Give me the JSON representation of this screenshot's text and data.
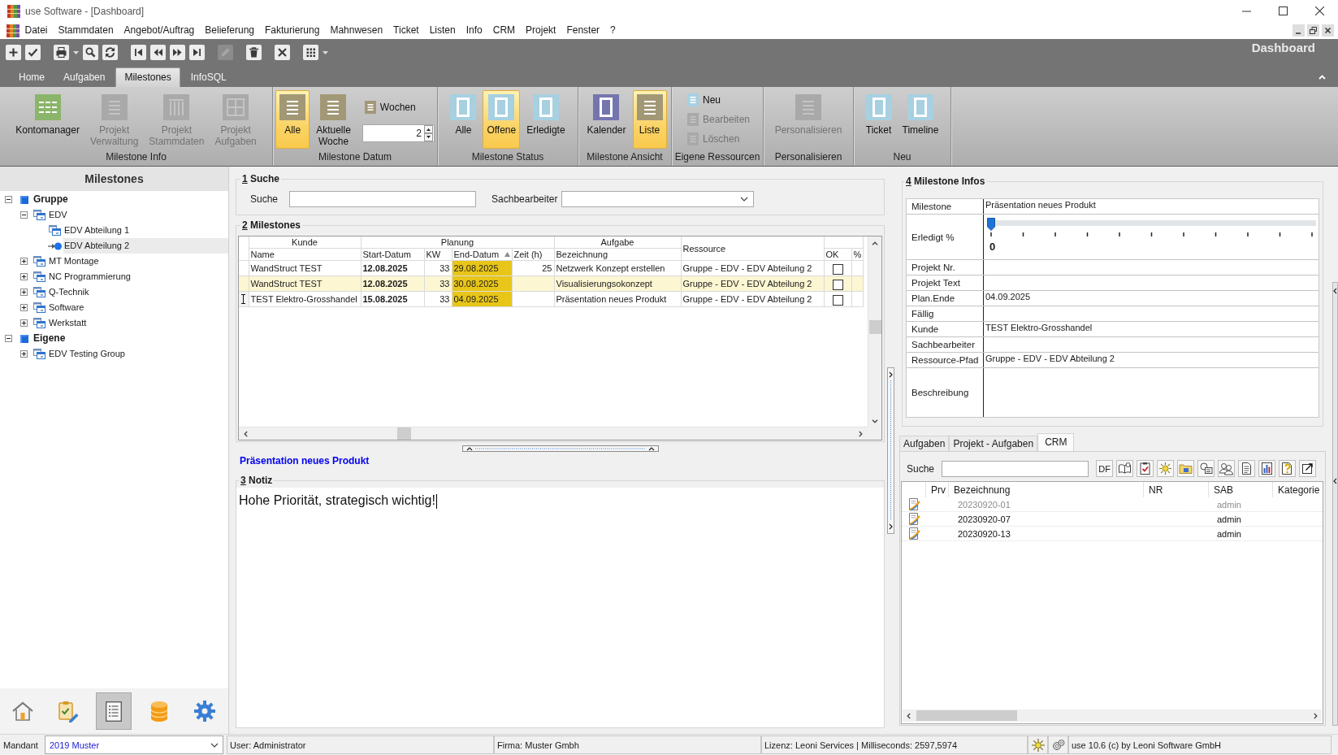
{
  "window": {
    "title": "use Software - [Dashboard]"
  },
  "menu": [
    "Datei",
    "Stammdaten",
    "Angebot/Auftrag",
    "Belieferung",
    "Fakturierung",
    "Mahnwesen",
    "Ticket",
    "Listen",
    "Info",
    "CRM",
    "Projekt",
    "Fenster",
    "?"
  ],
  "toolbar": [
    [
      {
        "kind": "add",
        "disabled": false
      },
      {
        "kind": "confirm",
        "disabled": false
      }
    ],
    [
      {
        "kind": "print",
        "disabled": false
      },
      {
        "kind": "dropdown",
        "disabled": false
      },
      {
        "kind": "search",
        "disabled": false
      },
      {
        "kind": "refresh",
        "disabled": false
      }
    ],
    [
      {
        "kind": "first",
        "disabled": false
      },
      {
        "kind": "previous",
        "disabled": false
      },
      {
        "kind": "next",
        "disabled": false
      },
      {
        "kind": "last",
        "disabled": false
      }
    ],
    [
      {
        "kind": "edit",
        "disabled": true
      }
    ],
    [
      {
        "kind": "delete",
        "disabled": false
      }
    ],
    [
      {
        "kind": "cancel",
        "disabled": false
      }
    ],
    [
      {
        "kind": "grid",
        "disabled": false
      },
      {
        "kind": "dropdown",
        "disabled": false
      }
    ]
  ],
  "ribbon": {
    "title": "Dashboard",
    "tabs": [
      {
        "label": "Home",
        "selected": false
      },
      {
        "label": "Aufgaben",
        "selected": false
      },
      {
        "label": "Milestones",
        "selected": true
      },
      {
        "label": "InfoSQL",
        "selected": false
      }
    ],
    "groups": [
      {
        "label": "Milestone Info",
        "buttons": [
          {
            "kind": "large",
            "label": "Kontomanager",
            "disabled": false,
            "selected": false
          },
          {
            "kind": "large",
            "label": "Projekt Verwaltung",
            "disabled": true,
            "selected": false
          },
          {
            "kind": "large",
            "label": "Projekt Stammdaten",
            "disabled": true,
            "selected": false
          },
          {
            "kind": "large",
            "label": "Projekt Aufgaben",
            "disabled": true,
            "selected": false
          }
        ]
      },
      {
        "label": "Milestone Datum",
        "buttons": [
          {
            "kind": "large",
            "label": "Alle",
            "disabled": false,
            "selected": true
          },
          {
            "kind": "large",
            "label": "Aktuelle Woche",
            "disabled": false,
            "selected": false
          },
          {
            "kind": "spin",
            "label": "Wochen",
            "value": "2",
            "disabled": false
          }
        ]
      },
      {
        "label": "Milestone Status",
        "buttons": [
          {
            "kind": "large",
            "label": "Alle",
            "disabled": false,
            "selected": false
          },
          {
            "kind": "large",
            "label": "Offene",
            "disabled": false,
            "selected": true
          },
          {
            "kind": "large",
            "label": "Erledigte",
            "disabled": false,
            "selected": false
          }
        ]
      },
      {
        "label": "Milestone Ansicht",
        "buttons": [
          {
            "kind": "large",
            "label": "Kalender",
            "disabled": false,
            "selected": false
          },
          {
            "kind": "large",
            "label": "Liste",
            "disabled": false,
            "selected": true
          }
        ]
      },
      {
        "label": "Eigene Ressourcen",
        "buttons": [
          {
            "kind": "small",
            "label": "Neu",
            "disabled": false
          },
          {
            "kind": "small",
            "label": "Bearbeiten",
            "disabled": true
          },
          {
            "kind": "small",
            "label": "Löschen",
            "disabled": true
          }
        ]
      },
      {
        "label": "Personalisieren",
        "buttons": [
          {
            "kind": "large",
            "label": "Personalisieren",
            "disabled": true,
            "selected": false
          }
        ]
      },
      {
        "label": "Neu",
        "buttons": [
          {
            "kind": "large",
            "label": "Ticket",
            "disabled": false,
            "selected": false
          },
          {
            "kind": "large",
            "label": "Timeline",
            "disabled": false,
            "selected": false
          }
        ]
      }
    ]
  },
  "sidebar": {
    "title": "Milestones",
    "tree": [
      {
        "kind": "root",
        "label": "Gruppe",
        "expanded": true,
        "selected": false,
        "children": [
          {
            "kind": "node",
            "label": "EDV",
            "expanded": true,
            "selected": false,
            "children": [
              {
                "kind": "leaf",
                "label": "EDV Abteilung 1",
                "selected": false
              },
              {
                "kind": "leaf",
                "label": "EDV Abteilung 2",
                "selected": true
              }
            ]
          },
          {
            "kind": "node",
            "label": "MT Montage",
            "expanded": false,
            "selected": false
          },
          {
            "kind": "node",
            "label": "NC Programmierung",
            "expanded": false,
            "selected": false
          },
          {
            "kind": "node",
            "label": "Q-Technik",
            "expanded": false,
            "selected": false
          },
          {
            "kind": "node",
            "label": "Software",
            "expanded": false,
            "selected": false
          },
          {
            "kind": "node",
            "label": "Werkstatt",
            "expanded": false,
            "selected": false
          }
        ]
      },
      {
        "kind": "root",
        "label": "Eigene",
        "expanded": true,
        "selected": false,
        "children": [
          {
            "kind": "node",
            "label": "EDV Testing Group",
            "expanded": false,
            "selected": false
          }
        ]
      }
    ],
    "nav": [
      {
        "kind": "home",
        "selected": false
      },
      {
        "kind": "tasks",
        "selected": false
      },
      {
        "kind": "list",
        "selected": true
      },
      {
        "kind": "database",
        "selected": false
      },
      {
        "kind": "settings",
        "selected": false
      }
    ]
  },
  "search": {
    "number": "1",
    "title": "Suche",
    "fields": [
      {
        "kind": "text",
        "label": "Suche"
      },
      {
        "kind": "combo",
        "label": "Sachbearbeiter"
      }
    ]
  },
  "milestones": {
    "number": "2",
    "title": "Milestones",
    "column_groups": [
      {
        "label": "Kunde",
        "columns": [
          {
            "label": "Name",
            "sorted": false
          }
        ]
      },
      {
        "label": "Planung",
        "columns": [
          {
            "label": "Start-Datum",
            "sorted": false
          },
          {
            "label": "KW",
            "sorted": false
          },
          {
            "label": "End-Datum",
            "sorted": true
          },
          {
            "label": "Zeit (h)",
            "sorted": false
          }
        ]
      },
      {
        "label": "Aufgabe",
        "columns": [
          {
            "label": "Bezeichnung",
            "sorted": false
          }
        ]
      },
      {
        "label": "Ressource"
      },
      {
        "columns": [
          {
            "label": "OK",
            "sorted": false
          },
          {
            "label": "%",
            "sorted": false
          }
        ]
      }
    ],
    "rows": [
      {
        "name": "WandStruct TEST",
        "start": "12.08.2025",
        "kw": "33",
        "end": "29.08.2025",
        "hours": "25",
        "task": "Netzwerk Konzept erstellen",
        "resource": "Gruppe - EDV - EDV Abteilung 2",
        "ok": false,
        "due": true,
        "selected": false,
        "focused": false
      },
      {
        "name": "WandStruct TEST",
        "start": "12.08.2025",
        "kw": "33",
        "end": "30.08.2025",
        "task": "Visualisierungsokonzept",
        "resource": "Gruppe - EDV - EDV Abteilung 2",
        "ok": false,
        "due": true,
        "selected": true,
        "focused": false
      },
      {
        "name": "TEST Elektro-Grosshandel",
        "start": "15.08.2025",
        "kw": "33",
        "end": "04.09.2025",
        "task": "Präsentation neues Produkt",
        "resource": "Gruppe - EDV - EDV Abteilung 2",
        "ok": false,
        "due": true,
        "selected": false,
        "focused": true
      }
    ]
  },
  "detail_title": "Präsentation neues Produkt",
  "note": {
    "number": "3",
    "title": "Notiz",
    "value": "Hohe Priorität, strategisch wichtig!"
  },
  "info": {
    "number": "4",
    "title": "Milestone Infos",
    "rows": [
      {
        "kind": "text",
        "label": "Milestone",
        "value": "Präsentation neues Produkt"
      },
      {
        "kind": "slider",
        "label": "Erledigt %",
        "level": 0,
        "reading": "0"
      },
      {
        "kind": "text",
        "label": "Projekt Nr."
      },
      {
        "kind": "text",
        "label": "Projekt Text"
      },
      {
        "kind": "text",
        "label": "Plan.Ende",
        "value": "04.09.2025"
      },
      {
        "kind": "text",
        "label": "Fällig"
      },
      {
        "kind": "text",
        "label": "Kunde",
        "value": "TEST Elektro-Grosshandel"
      },
      {
        "kind": "text",
        "label": "Sachbearbeiter"
      },
      {
        "kind": "text",
        "label": "Ressource-Pfad",
        "value": "Gruppe - EDV - EDV Abteilung 2"
      },
      {
        "kind": "memo",
        "label": "Beschreibung"
      }
    ]
  },
  "detail_tabs": [
    {
      "label": "Aufgaben",
      "selected": false
    },
    {
      "label": "Projekt - Aufgaben",
      "selected": false
    },
    {
      "label": "CRM",
      "selected": true
    }
  ],
  "crm": {
    "search_label": "Suche",
    "filter_label": "DF",
    "columns": [
      "Prv",
      "Bezeichnung",
      "NR",
      "SAB",
      "Kategorie"
    ],
    "rows": [
      {
        "bezeichnung": "20230920-01",
        "sab": "admin",
        "dimmed": true
      },
      {
        "bezeichnung": "20230920-07",
        "sab": "admin",
        "dimmed": false
      },
      {
        "bezeichnung": "20230920-13",
        "sab": "admin",
        "dimmed": false
      }
    ]
  },
  "status_bar": {
    "mandant_label": "Mandant",
    "mandant": "2019 Muster",
    "user": "User: Administrator",
    "company": "Firma: Muster Gmbh",
    "license": "Lizenz: Leoni Services | Milliseconds: 2597,5974",
    "version": "use 10.6 (c) by Leoni Software GmbH"
  }
}
